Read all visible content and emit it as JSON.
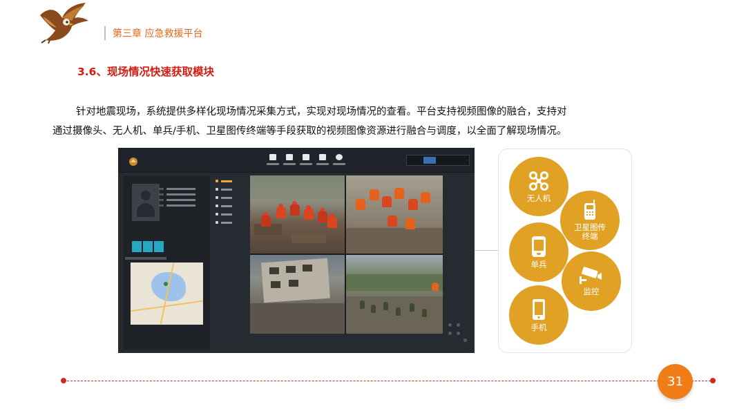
{
  "header": {
    "chapter": "第三章  应急救援平台"
  },
  "section": {
    "title": "3.6、现场情况快速获取模块"
  },
  "body": {
    "line1": "针对地震现场，系统提供多样化现场情况采集方式，实现对现场情况的查看。平台支持视频图像的融合，支持对",
    "line2": "通过摄像头、无人机、单兵/手机、卫星图传终端等手段获取的视频图像资源进行融合与调度，以全面了解现场情况。"
  },
  "circles": [
    {
      "label": "无人机",
      "icon": "drone-icon"
    },
    {
      "label": "卫星图传\n终端",
      "icon": "satellite-phone-icon"
    },
    {
      "label": "单兵",
      "icon": "handheld-terminal-icon"
    },
    {
      "label": "监控",
      "icon": "surveillance-camera-icon"
    },
    {
      "label": "手机",
      "icon": "mobile-phone-icon"
    }
  ],
  "footer": {
    "page_number": "31"
  },
  "colors": {
    "chapter": "#e8661b",
    "title": "#d7190f",
    "circle_fill": "#e1a125",
    "page_badge": "#f07d17",
    "footer_line": "#cc2a20"
  }
}
